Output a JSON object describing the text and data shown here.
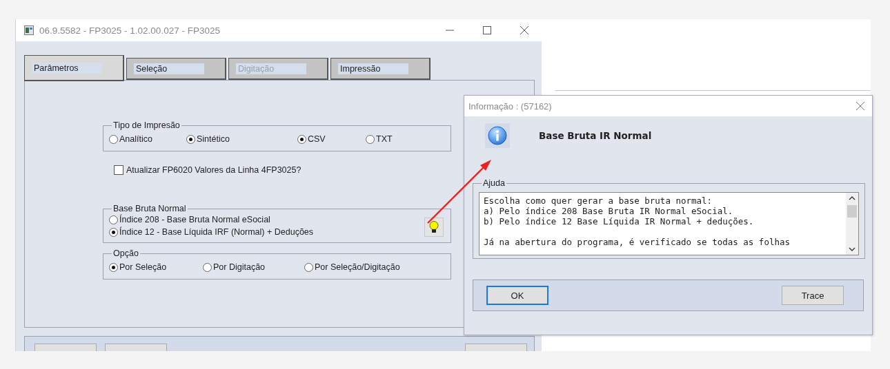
{
  "main_window": {
    "title": "06.9.5582 - FP3025 - 1.02.00.027 - FP3025"
  },
  "tabs": [
    {
      "label": "Parâmetros",
      "selected": true,
      "disabled": false
    },
    {
      "label": "Seleção",
      "selected": false,
      "disabled": false
    },
    {
      "label": "Digitação",
      "selected": false,
      "disabled": true
    },
    {
      "label": "Impressão",
      "selected": false,
      "disabled": false
    }
  ],
  "tipo_impressao": {
    "label": "Tipo de Impresão",
    "options": [
      {
        "label": "Analítico",
        "selected": false
      },
      {
        "label": "Sintético",
        "selected": true
      }
    ],
    "formats": [
      {
        "label": "CSV",
        "selected": true
      },
      {
        "label": "TXT",
        "selected": false
      }
    ]
  },
  "update_checkbox": {
    "label": "Atualizar FP6020 Valores da Linha 4FP3025?",
    "checked": false
  },
  "base_bruta_normal": {
    "label": "Base Bruta Normal",
    "options": [
      {
        "label": "Índice 208 - Base Bruta Normal eSocial",
        "selected": false
      },
      {
        "label": "Índice 12 - Base Líquida IRF (Normal) + Deduções",
        "selected": true
      }
    ]
  },
  "opcao": {
    "label": "Opção",
    "options": [
      {
        "label": "Por Seleção",
        "selected": true
      },
      {
        "label": "Por Digitação",
        "selected": false
      },
      {
        "label": "Por Seleção/Digitação",
        "selected": false
      }
    ]
  },
  "dialog": {
    "title": "Informação : (57162)",
    "heading": "Base Bruta IR Normal",
    "group_label": "Ajuda",
    "help_paragraphs": [
      {
        "lines": [
          "Escolha como quer gerar a base bruta normal:",
          "a) Pelo índice 208 Base Bruta IR Normal eSocial.",
          "b) Pelo índice 12 Base Líquida IR Normal + deduções."
        ]
      },
      {
        "lines": [
          "Já na abertura do programa, é verificado se todas as folhas"
        ]
      }
    ],
    "buttons": [
      {
        "label": "OK",
        "focused": true
      },
      {
        "label": "Trace",
        "focused": false
      }
    ]
  }
}
